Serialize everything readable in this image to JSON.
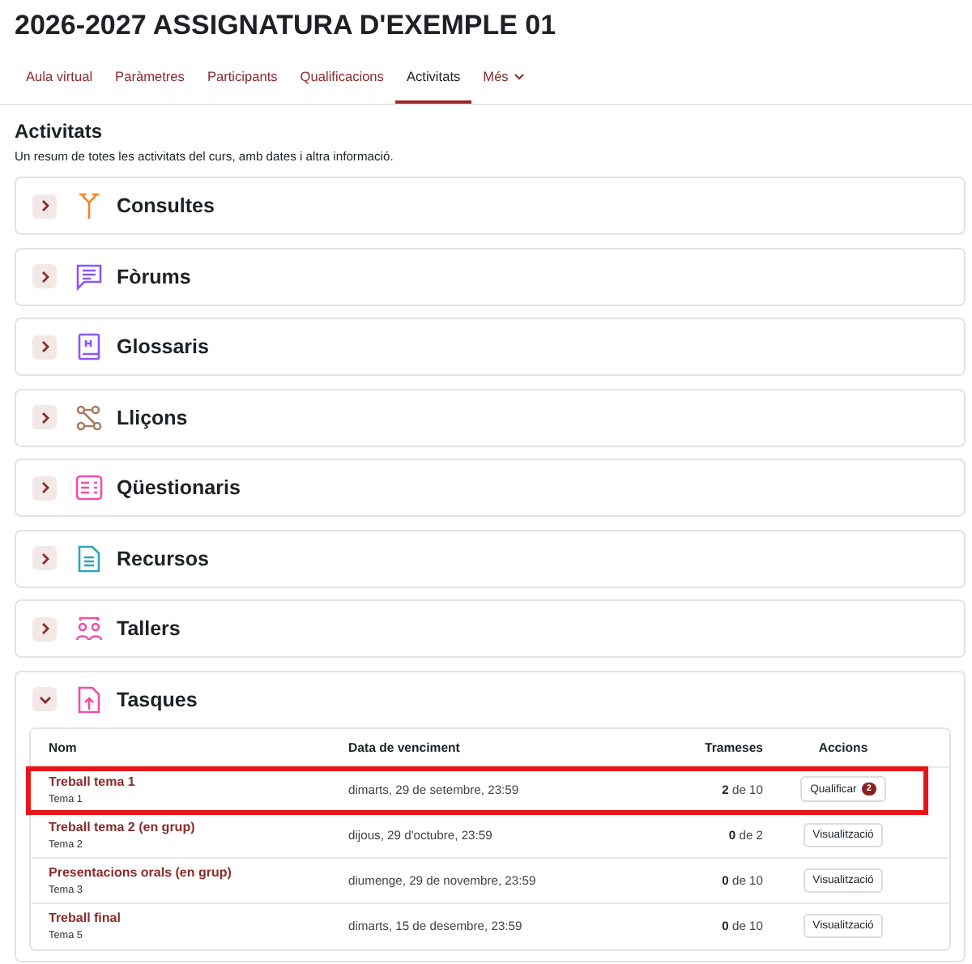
{
  "course_title": "2026-2027 ASSIGNATURA D'EXEMPLE 01",
  "tabs": [
    {
      "label": "Aula virtual",
      "selected": false,
      "dropdown": false
    },
    {
      "label": "Paràmetres",
      "selected": false,
      "dropdown": false
    },
    {
      "label": "Participants",
      "selected": false,
      "dropdown": false
    },
    {
      "label": "Qualificacions",
      "selected": false,
      "dropdown": false
    },
    {
      "label": "Activitats",
      "selected": true,
      "dropdown": false
    },
    {
      "label": "Més",
      "selected": false,
      "dropdown": true
    }
  ],
  "page_heading": "Activitats",
  "description": "Un resum de totes les activitats del curs, amb dates i altra informació.",
  "sections": [
    {
      "title": "Consultes",
      "kind": "choice",
      "color": "#f7831f",
      "expanded": false
    },
    {
      "title": "Fòrums",
      "kind": "forum",
      "color": "#8c56f5",
      "expanded": false
    },
    {
      "title": "Glossaris",
      "kind": "glossary",
      "color": "#8c56f5",
      "expanded": false
    },
    {
      "title": "Lliçons",
      "kind": "lesson",
      "color": "#a97a62",
      "expanded": false
    },
    {
      "title": "Qüestionaris",
      "kind": "quiz",
      "color": "#f04fa6",
      "expanded": false
    },
    {
      "title": "Recursos",
      "kind": "resource",
      "color": "#2ba7b8",
      "expanded": false
    },
    {
      "title": "Tallers",
      "kind": "workshop",
      "color": "#f04fa6",
      "expanded": false
    },
    {
      "title": "Tasques",
      "kind": "assignment",
      "color": "#f04fa6",
      "expanded": true,
      "table": {
        "columns": [
          "Nom",
          "Data de venciment",
          "Trameses",
          "Accions"
        ],
        "rows": [
          {
            "name": "Treball tema 1",
            "topic": "Tema 1",
            "due": "dimarts, 29 de setembre, 23:59",
            "submissions": "**2** de 10",
            "action": "Qualificar",
            "badge": "2",
            "highlighted": true
          },
          {
            "name": "Treball tema 2 (en grup)",
            "topic": "Tema 2",
            "due": "dijous, 29 d'octubre, 23:59",
            "submissions": "**0** de 2",
            "action": "Visualització",
            "highlighted": false
          },
          {
            "name": "Presentacions orals (en grup)",
            "topic": "Tema 3",
            "due": "diumenge, 29 de novembre, 23:59",
            "submissions": "**0** de 10",
            "action": "Visualització",
            "highlighted": false
          },
          {
            "name": "Treball final",
            "topic": "Tema 5",
            "due": "dimarts, 15 de desembre, 23:59",
            "submissions": "**0** de 10",
            "action": "Visualització",
            "highlighted": false
          }
        ]
      }
    }
  ]
}
